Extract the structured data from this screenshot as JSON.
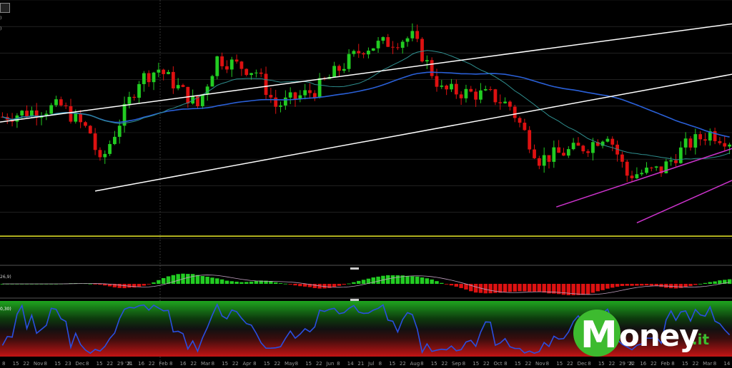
{
  "chart_data": [
    {
      "type": "candlestick",
      "title": "",
      "panel": "price",
      "ylim": [
        0,
        100
      ],
      "grid": true,
      "ohlc": [],
      "moving_averages": [
        {
          "color": "#2a60d8",
          "values": []
        },
        {
          "color": "#2f8f8f",
          "values": []
        }
      ],
      "trendlines": [
        {
          "color": "#ffffff",
          "points": [
            [
              0,
              54
            ],
            [
              100,
              91
            ]
          ]
        },
        {
          "color": "#ffffff",
          "points": [
            [
              13,
              28
            ],
            [
              100,
              72
            ]
          ]
        },
        {
          "color": "#cc33cc",
          "points": [
            [
              76,
              22
            ],
            [
              100,
              44
            ]
          ]
        },
        {
          "color": "#cc33cc",
          "points": [
            [
              87,
              16
            ],
            [
              100,
              32
            ]
          ]
        }
      ],
      "support_line": {
        "color": "#e8e82a",
        "value": 11
      }
    },
    {
      "type": "histogram",
      "panel": "macd",
      "legend_text": "26,9)",
      "values": []
    },
    {
      "type": "line",
      "panel": "oscillator",
      "legend_text": "0,30)",
      "ylim": [
        0,
        100
      ],
      "values": []
    }
  ],
  "x_labels": [
    "8",
    "15",
    "22",
    "Nov",
    "8",
    "15",
    "23",
    "Dec",
    "8",
    "15",
    "22",
    "29 '21",
    "8",
    "16",
    "22",
    "Feb",
    "8",
    "16",
    "22",
    "Mar",
    "8",
    "15",
    "22",
    "Apr",
    "8",
    "15",
    "22",
    "May",
    "8",
    "15",
    "22",
    "Jun",
    "8",
    "14",
    "21",
    "Jul",
    "8",
    "15",
    "22",
    "Aug",
    "8",
    "15",
    "22",
    "Sep",
    "8",
    "15",
    "22",
    "Oct",
    "8",
    "15",
    "22",
    "Nov",
    "8",
    "15",
    "22",
    "Dec",
    "8",
    "15",
    "22",
    "29 '22",
    "8",
    "16",
    "22",
    "Feb",
    "8",
    "15",
    "22",
    "Mar",
    "8",
    "14"
  ],
  "toolbar": {
    "labels": [
      ")",
      ")"
    ]
  },
  "brand": {
    "logo_letter": "M",
    "name": "oney",
    "suffix": ".it",
    "green": "#3dbb2f"
  },
  "colors": {
    "up": "#22cc22",
    "down": "#dd1111",
    "grid": "#333333"
  }
}
